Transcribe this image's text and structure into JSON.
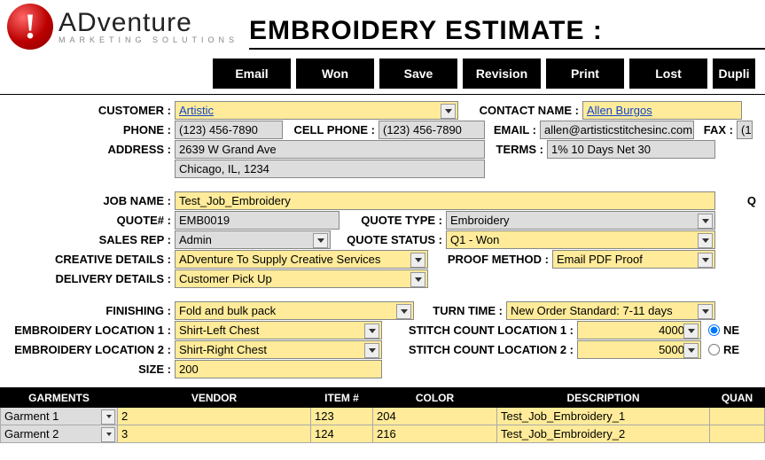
{
  "logo": {
    "brand_a": "AD",
    "brand_b": "venture",
    "tagline": "MARKETING SOLUTIONS"
  },
  "page_title": "EMBROIDERY ESTIMATE :",
  "toolbar": {
    "email": "Email",
    "won": "Won",
    "save": "Save",
    "revision": "Revision",
    "print": "Print",
    "lost": "Lost",
    "dupli": "Dupli"
  },
  "labels": {
    "customer": "CUSTOMER",
    "contact": "CONTACT NAME",
    "phone": "PHONE",
    "cell": "CELL PHONE",
    "email": "EMAIL",
    "fax": "FAX",
    "address": "ADDRESS",
    "terms": "TERMS",
    "job_name": "JOB NAME",
    "quote_no": "QUOTE#",
    "quote_type": "QUOTE TYPE",
    "sales_rep": "SALES REP",
    "quote_status": "QUOTE STATUS",
    "creative": "CREATIVE DETAILS",
    "proof": "PROOF METHOD",
    "delivery": "DELIVERY DETAILS",
    "finishing": "FINISHING",
    "turn": "TURN TIME",
    "emb_loc1": "EMBROIDERY LOCATION 1",
    "stitch1": "STITCH COUNT LOCATION 1",
    "emb_loc2": "EMBROIDERY LOCATION 2",
    "stitch2": "STITCH COUNT LOCATION 2",
    "size": "SIZE",
    "q_side": "Q",
    "ne": "NE",
    "re": "RE"
  },
  "values": {
    "customer": "Artistic",
    "contact": "Allen Burgos",
    "phone": "(123) 456-7890",
    "cell": "(123) 456-7890",
    "email": "allen@artisticstitchesinc.com",
    "fax": "(1",
    "address1": "2639 W Grand Ave",
    "address2": "Chicago, IL, 1234",
    "terms": "1% 10 Days Net 30",
    "job_name": "Test_Job_Embroidery",
    "quote_no": "EMB0019",
    "quote_type": "Embroidery",
    "sales_rep": "Admin",
    "quote_status": "Q1 - Won",
    "creative": "ADventure To Supply Creative Services",
    "proof": "Email PDF Proof",
    "delivery": "Customer Pick Up",
    "finishing": "Fold and bulk pack",
    "turn": "New Order Standard: 7-11 days",
    "emb_loc1": "Shirt-Left Chest",
    "stitch1": "4000",
    "emb_loc2": "Shirt-Right Chest",
    "stitch2": "5000",
    "size": "200"
  },
  "table": {
    "headers": {
      "garments": "GARMENTS",
      "vendor": "VENDOR",
      "item": "ITEM #",
      "color": "COLOR",
      "desc": "DESCRIPTION",
      "quant": "QUAN"
    },
    "rows": [
      {
        "garment": "Garment 1",
        "vendor": "2",
        "item": "123",
        "color": "204",
        "desc": "Test_Job_Embroidery_1"
      },
      {
        "garment": "Garment 2",
        "vendor": "3",
        "item": "124",
        "color": "216",
        "desc": "Test_Job_Embroidery_2"
      }
    ]
  }
}
